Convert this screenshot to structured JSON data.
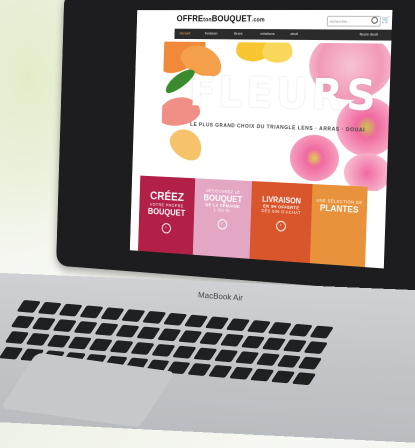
{
  "site": {
    "logo_part1": "OFFRE",
    "logo_part2": "ton",
    "logo_part3": "BOUQUET",
    "logo_part4": ".com",
    "search_placeholder": "rechercher...",
    "nav": [
      "accueil",
      "livraison",
      "fleurs",
      "créations",
      "deuil"
    ],
    "nav_right": "fleurs deuil"
  },
  "hero": {
    "title": "FLEURS",
    "tagline": "LE PLUS GRAND CHOIX DU TRIANGLE LENS · ARRAS · DOUAI"
  },
  "tiles": [
    {
      "small": "",
      "big": "CRÉEZ",
      "mid": "VOTRE PROPRE",
      "big2": "BOUQUET",
      "color": "#b21f47"
    },
    {
      "small": "DÉCOUVREZ LE",
      "big": "BOUQUET",
      "mid": "DE LA SEMAINE",
      "big2": "L OU XL",
      "color": "#e3a7c4"
    },
    {
      "small": "",
      "big": "LIVRAISON",
      "mid": "EN 3H OFFERTE",
      "big2": "DÈS 50€ D'ACHAT",
      "color": "#d9552b"
    },
    {
      "small": "UNE SÉLECTION DE",
      "big": "PLANTES",
      "mid": "",
      "big2": "",
      "color": "#e8923c"
    }
  ],
  "laptop": {
    "brand": "MacBook Air"
  },
  "colors": {
    "nav_bg": "#2b2b2b",
    "accent": "#e8b84a"
  }
}
